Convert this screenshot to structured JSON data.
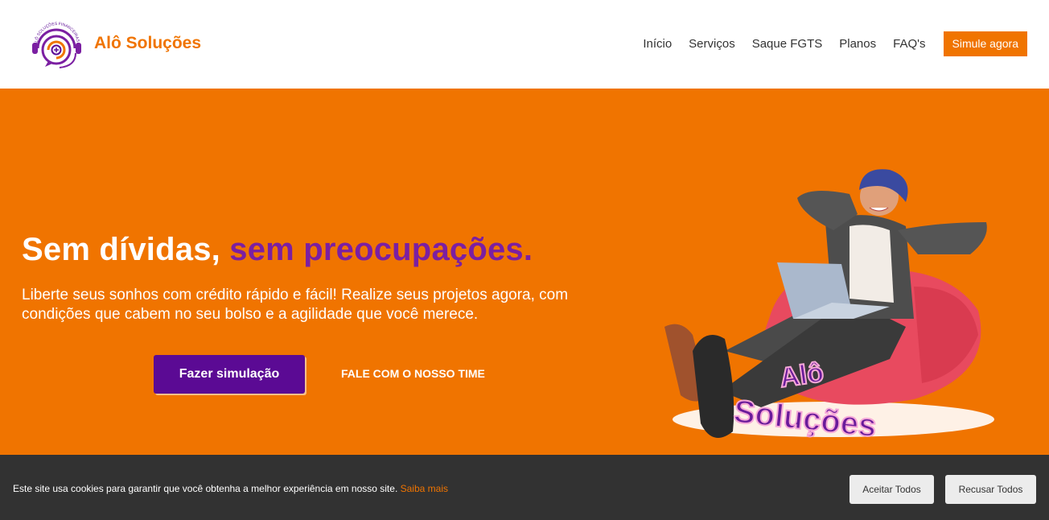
{
  "header": {
    "brand": "Alô Soluções",
    "logo_arc_text": "ALÔ SOLUÇÕES FINANCEIRAS",
    "nav": [
      "Início",
      "Serviços",
      "Saque FGTS",
      "Planos",
      "FAQ's"
    ],
    "cta_label": "Simule agora"
  },
  "hero": {
    "title_main": "Sem dívidas,",
    "title_accent": "sem preocupações.",
    "lead": "Liberte seus sonhos com crédito rápido e fácil! Realize seus projetos agora, com condições que cabem no seu bolso e a agilidade que você merece.",
    "primary_button": "Fazer simulação",
    "secondary_button": "FALE COM O NOSSO TIME",
    "illustration_text_1": "Alô",
    "illustration_text_2": "Soluções"
  },
  "cookie": {
    "text": "Este site usa cookies para garantir que você obtenha a melhor experiência em nosso site.",
    "link": "Saiba mais",
    "accept": "Aceitar Todos",
    "refuse": "Recusar Todos"
  },
  "colors": {
    "brand_orange": "#f07400",
    "brand_purple": "#7b1fa2",
    "button_purple": "#5b0a94",
    "cookie_bg": "#323232"
  }
}
